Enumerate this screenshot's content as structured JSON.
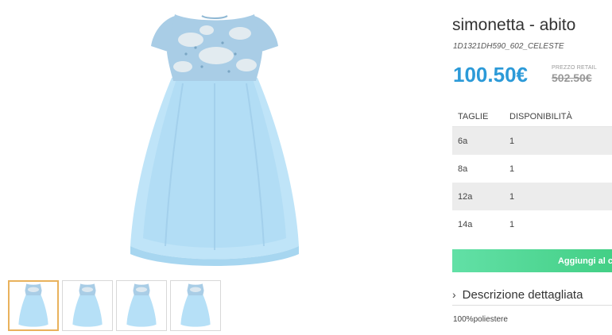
{
  "product": {
    "title": "simonetta - abito",
    "sku": "1D1321DH590_602_CELESTE",
    "price": "100.50€",
    "retail_label": "PREZZO RETAIL",
    "retail_price": "502.50€"
  },
  "sizes_table": {
    "headers": [
      "TAGLIE",
      "DISPONIBILITÀ"
    ],
    "rows": [
      {
        "size": "6a",
        "availability": "1"
      },
      {
        "size": "8a",
        "availability": "1"
      },
      {
        "size": "12a",
        "availability": "1"
      },
      {
        "size": "14a",
        "availability": "1"
      }
    ]
  },
  "cart_button_label": "Aggiungi al c",
  "description": {
    "toggle_label": "Descrizione dettagliata",
    "text": "100%poliestere"
  },
  "gallery": {
    "thumbnail_count": 4,
    "selected_index": 0
  },
  "colors": {
    "price": "#2c9ad8",
    "cart_button": "#4fd891",
    "active_thumb_border": "#e9b25c",
    "dress_bodice": "#a9cde6",
    "dress_skirt": "#b6e0f7"
  }
}
